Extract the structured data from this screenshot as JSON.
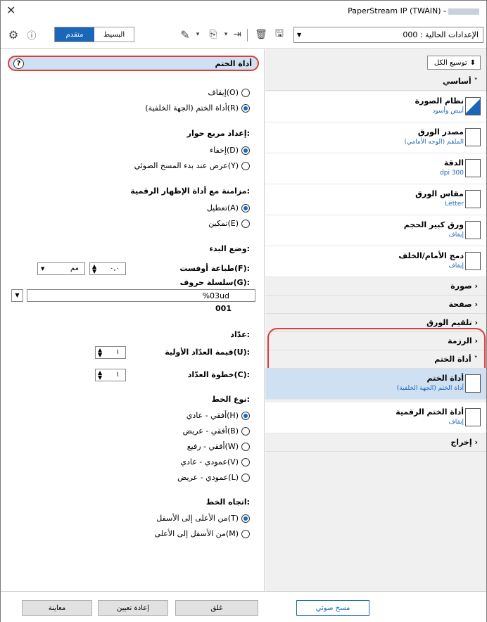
{
  "window": {
    "title": "PaperStream IP (TWAIN) -",
    "close_glyph": "✕"
  },
  "toolbar": {
    "mode_basic": "البسيط",
    "mode_advanced": "متقدم",
    "setting_value": "000 : الإعدادات الحالية"
  },
  "left": {
    "header_title": "أداة الختم",
    "help_glyph": "?",
    "imprinter": {
      "off": "إيقاف(O)",
      "on_back": "أداة الختم (الجهة الخلفية)(R)"
    },
    "dialog_section": "إعداد مربع حوار:",
    "dialog": {
      "hide": "إخفاء(D)",
      "show": "عرض عند بدء المسح الضوئي(Y)"
    },
    "sync_section": "مزامنة مع أداة الإظهار الرقمية:",
    "sync": {
      "disable": "تعطيل(A)",
      "enable": "تمكين(E)"
    },
    "start_section": "وضع البدء:",
    "offset_label": "طباعة أوفست(F):",
    "offset_value": "٠,٠",
    "unit_value": "مم",
    "string_label": "سلسلة حروف(G):",
    "string_value": "%03ud",
    "string_preview": "001",
    "counter_section": "عدّاد:",
    "counter_initial_label": "قيمة العدّاد الأولية(U):",
    "counter_initial_value": "١",
    "counter_step_label": "خطوة العدّاد(C):",
    "counter_step_value": "١",
    "font_section": "نوع الخط:",
    "font": {
      "h_normal": "أفقي - عادي(H)",
      "h_bold": "أفقي - عريض(B)",
      "h_narrow": "أفقي - رفيع(W)",
      "v_normal": "عمودي - عادي(V)",
      "v_bold": "عمودي - عريض(L)"
    },
    "direction_section": "اتجاه الخط:",
    "direction": {
      "top_bottom": "من الأعلى إلى الأسفل(T)",
      "bottom_top": "من الأسفل إلى الأعلى(M)"
    }
  },
  "right": {
    "expand_all": "توسيع الكل",
    "basic_cat": "أساسي",
    "items": {
      "image_mode": {
        "name": "نظام الصورة",
        "value": "أبيض وأسود"
      },
      "paper_source": {
        "name": "مصدر الورق",
        "value": "الملقم (الوجه الأمامي)"
      },
      "resolution": {
        "name": "الدقة",
        "value": "dpi 300"
      },
      "paper_size": {
        "name": "مقاس الورق",
        "value": "Letter"
      },
      "long_paper": {
        "name": "ورق كبير الحجم",
        "value": "إيقاف"
      },
      "merge": {
        "name": "دمج الأمام/الخلف",
        "value": "إيقاف"
      },
      "imprinter": {
        "name": "أداة الختم",
        "value": "أداة الختم (الجهة الخلفية)"
      },
      "digital_endorser": {
        "name": "أداة الختم الرقمية",
        "value": "إيقاف"
      }
    },
    "cats": {
      "image": "صورة",
      "page": "صفحة",
      "feed": "تلقيم الورق",
      "batch": "الرزمة",
      "imprinter": "أداة الختم",
      "output": "إخراج"
    }
  },
  "footer": {
    "preview": "معاينة",
    "reset": "إعادة تعيين",
    "close": "غلق",
    "scan": "مسح ضوئي"
  }
}
